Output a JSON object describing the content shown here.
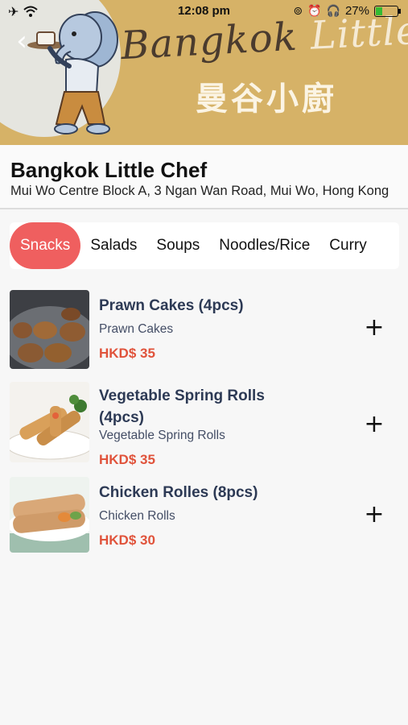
{
  "status_bar": {
    "time": "12:08 pm",
    "battery_percent": "27%",
    "battery_level": 0.27,
    "left_icons": [
      "airplane-icon",
      "wifi-icon"
    ],
    "right_icons": [
      "lock-rotation-icon",
      "alarm-icon",
      "headphones-icon"
    ]
  },
  "banner": {
    "script_title_dark": "Bangkok ",
    "script_title_light": "Little Chef",
    "chinese_title": "曼谷小廚"
  },
  "navigation": {
    "back_icon": "chevron-left-icon",
    "back_glyph": "‹"
  },
  "restaurant": {
    "name": "Bangkok Little Chef",
    "address": "Mui Wo Centre Block A, 3 Ngan Wan Road, Mui Wo, Hong Kong"
  },
  "categories": {
    "active_index": 0,
    "items": [
      {
        "label": "Snacks"
      },
      {
        "label": "Salads"
      },
      {
        "label": "Soups"
      },
      {
        "label": "Noodles/Rice"
      },
      {
        "label": "Curry"
      }
    ]
  },
  "menu": {
    "add_glyph": "+",
    "items": [
      {
        "title": "Prawn Cakes (4pcs)",
        "description": "Prawn Cakes",
        "price": "HKD$ 35"
      },
      {
        "title": "Vegetable Spring Rolls (4pcs)",
        "description": "Vegetable Spring Rolls",
        "price": "HKD$ 35"
      },
      {
        "title": "Chicken Rolles (8pcs)",
        "description": "Chicken Rolls",
        "price": "HKD$ 30"
      }
    ]
  },
  "colors": {
    "banner": "#d6b267",
    "active_tab": "#ef5f5f",
    "price": "#e0533b",
    "item_title": "#2d3a55"
  }
}
